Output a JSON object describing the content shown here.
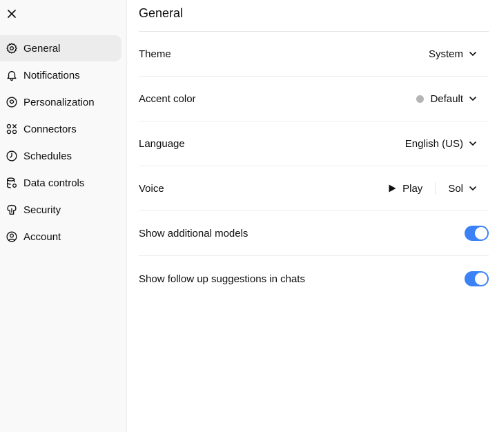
{
  "colors": {
    "accent": "#3b82f6",
    "sidebar_bg": "#f9f9f9",
    "active_item_bg": "#ececec",
    "accent_dot": "#b4b4b4"
  },
  "sidebar": {
    "close_icon": "close-icon",
    "items": [
      {
        "label": "General",
        "icon": "gear-icon",
        "active": true
      },
      {
        "label": "Notifications",
        "icon": "bell-icon",
        "active": false
      },
      {
        "label": "Personalization",
        "icon": "personalization-icon",
        "active": false
      },
      {
        "label": "Connectors",
        "icon": "connectors-icon",
        "active": false
      },
      {
        "label": "Schedules",
        "icon": "clock-icon",
        "active": false
      },
      {
        "label": "Data controls",
        "icon": "database-icon",
        "active": false
      },
      {
        "label": "Security",
        "icon": "security-icon",
        "active": false
      },
      {
        "label": "Account",
        "icon": "user-circle-icon",
        "active": false
      }
    ]
  },
  "main": {
    "title": "General",
    "theme": {
      "label": "Theme",
      "value": "System"
    },
    "accent_color": {
      "label": "Accent color",
      "value": "Default"
    },
    "language": {
      "label": "Language",
      "value": "English (US)"
    },
    "voice": {
      "label": "Voice",
      "play_label": "Play",
      "value": "Sol"
    },
    "show_additional_models": {
      "label": "Show additional models",
      "enabled": true
    },
    "show_follow_up": {
      "label": "Show follow up suggestions in chats",
      "enabled": true
    }
  }
}
